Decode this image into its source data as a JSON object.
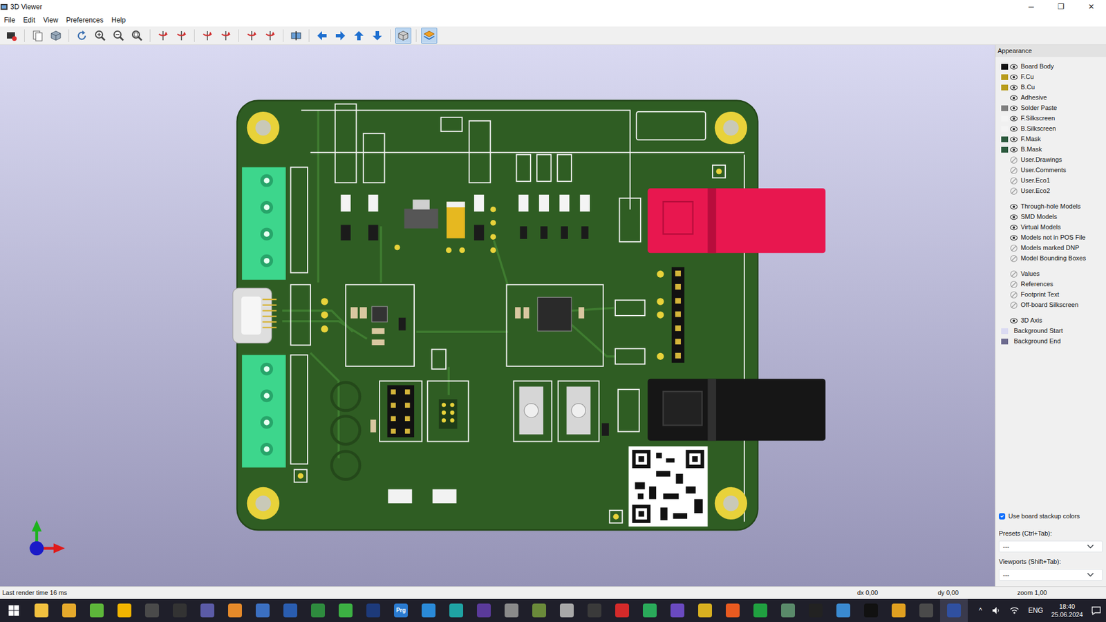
{
  "window": {
    "title": "3D Viewer",
    "controls": [
      "─",
      "❐",
      "✕"
    ]
  },
  "menu": [
    "File",
    "Edit",
    "View",
    "Preferences",
    "Help"
  ],
  "toolbar": [
    {
      "kind": "render",
      "selected": false
    },
    {
      "kind": "sep"
    },
    {
      "kind": "copy",
      "selected": false
    },
    {
      "kind": "board",
      "selected": false
    },
    {
      "kind": "sep"
    },
    {
      "kind": "reload",
      "selected": false
    },
    {
      "kind": "zoom-in",
      "selected": false
    },
    {
      "kind": "zoom-out",
      "selected": false
    },
    {
      "kind": "zoom-fit",
      "selected": false
    },
    {
      "kind": "sep"
    },
    {
      "kind": "rotate",
      "selected": false
    },
    {
      "kind": "rotate",
      "selected": false
    },
    {
      "kind": "sep"
    },
    {
      "kind": "rotate",
      "selected": false
    },
    {
      "kind": "rotate",
      "selected": false
    },
    {
      "kind": "sep"
    },
    {
      "kind": "rotate",
      "selected": false
    },
    {
      "kind": "rotate",
      "selected": false
    },
    {
      "kind": "sep"
    },
    {
      "kind": "flip",
      "selected": false
    },
    {
      "kind": "sep"
    },
    {
      "kind": "arrow-left",
      "selected": false
    },
    {
      "kind": "arrow-right",
      "selected": false
    },
    {
      "kind": "arrow-up",
      "selected": false
    },
    {
      "kind": "arrow-down",
      "selected": false
    },
    {
      "kind": "sep"
    },
    {
      "kind": "ortho",
      "selected": true
    },
    {
      "kind": "sep"
    },
    {
      "kind": "layers",
      "selected": true
    }
  ],
  "appearance": {
    "title": "Appearance",
    "groups": [
      [
        {
          "label": "Board Body",
          "kind": "layer",
          "visible": true,
          "color": "#111111"
        },
        {
          "label": "F.Cu",
          "kind": "layer",
          "visible": true,
          "color": "#b89c1c"
        },
        {
          "label": "B.Cu",
          "kind": "layer",
          "visible": true,
          "color": "#b89c1c"
        },
        {
          "label": "Adhesive",
          "kind": "layer",
          "visible": true
        },
        {
          "label": "Solder Paste",
          "kind": "layer",
          "visible": true,
          "color": "#808080"
        },
        {
          "label": "F.Silkscreen",
          "kind": "layer",
          "visible": true,
          "color": "#f4f4f4"
        },
        {
          "label": "B.Silkscreen",
          "kind": "layer",
          "visible": true,
          "color": "#f4f4f4"
        },
        {
          "label": "F.Mask",
          "kind": "layer",
          "visible": true,
          "color": "#2c5a3e"
        },
        {
          "label": "B.Mask",
          "kind": "layer",
          "visible": true,
          "color": "#2c5a3e"
        },
        {
          "label": "User.Drawings",
          "kind": "layer",
          "visible": false
        },
        {
          "label": "User.Comments",
          "kind": "layer",
          "visible": false
        },
        {
          "label": "User.Eco1",
          "kind": "layer",
          "visible": false
        },
        {
          "label": "User.Eco2",
          "kind": "layer",
          "visible": false
        }
      ],
      [
        {
          "label": "Through-hole Models",
          "kind": "layer",
          "visible": true
        },
        {
          "label": "SMD Models",
          "kind": "layer",
          "visible": true
        },
        {
          "label": "Virtual Models",
          "kind": "layer",
          "visible": true
        },
        {
          "label": "Models not in POS File",
          "kind": "layer",
          "visible": true
        },
        {
          "label": "Models marked DNP",
          "kind": "layer",
          "visible": false
        },
        {
          "label": "Model Bounding Boxes",
          "kind": "layer",
          "visible": false
        }
      ],
      [
        {
          "label": "Values",
          "kind": "layer",
          "visible": false
        },
        {
          "label": "References",
          "kind": "layer",
          "visible": false
        },
        {
          "label": "Footprint Text",
          "kind": "layer",
          "visible": false
        },
        {
          "label": "Off-board Silkscreen",
          "kind": "layer",
          "visible": false
        }
      ],
      [
        {
          "label": "3D Axis",
          "kind": "layer",
          "visible": true
        },
        {
          "label": "Background Start",
          "kind": "color-only",
          "color": "#dadaf2"
        },
        {
          "label": "Background End",
          "kind": "color-only",
          "color": "#6d6b8f"
        }
      ]
    ],
    "stackup": {
      "label": "Use board stackup colors",
      "checked": true
    },
    "presets": {
      "label": "Presets (Ctrl+Tab):",
      "value": "---"
    },
    "viewports": {
      "label": "Viewports (Shift+Tab):",
      "value": "---"
    }
  },
  "status_bar": [
    "Last render time 16 ms",
    "dx 0,00",
    "dy 0,00",
    "zoom 1,00"
  ],
  "taskbar": {
    "apps": [
      {
        "color": "#f2c13f",
        "selected": false
      },
      {
        "color": "#e5a92c",
        "selected": false
      },
      {
        "color": "#5db63a",
        "selected": false
      },
      {
        "color": "#f1b400",
        "selected": false
      },
      {
        "color": "#4a4a4a",
        "selected": false
      },
      {
        "color": "#333333",
        "selected": false
      },
      {
        "color": "#5b5ba6",
        "selected": false
      },
      {
        "color": "#e58a2a",
        "selected": false
      },
      {
        "color": "#3b6fc1",
        "selected": false
      },
      {
        "color": "#2a5db0",
        "selected": false
      },
      {
        "color": "#2e8b3e",
        "selected": false
      },
      {
        "color": "#3cb043",
        "selected": false
      },
      {
        "color": "#1d3a7a",
        "selected": false
      },
      {
        "color": "#2a7ad0",
        "selected": false,
        "label": "Prg"
      },
      {
        "color": "#2a8ad8",
        "selected": false
      },
      {
        "color": "#1fa3a3",
        "selected": false
      },
      {
        "color": "#5a3a9a",
        "selected": false
      },
      {
        "color": "#8a8a8a",
        "selected": false
      },
      {
        "color": "#6a8a3a",
        "selected": false
      },
      {
        "color": "#a8a8a8",
        "selected": false
      },
      {
        "color": "#3a3a3a",
        "selected": false
      },
      {
        "color": "#d42a2a",
        "selected": false
      },
      {
        "color": "#2aaa5a",
        "selected": false
      },
      {
        "color": "#6a4ac0",
        "selected": false
      },
      {
        "color": "#d8b020",
        "selected": false
      },
      {
        "color": "#e85a20",
        "selected": false
      },
      {
        "color": "#20a040",
        "selected": false
      },
      {
        "color": "#5a8a6a",
        "selected": false
      },
      {
        "color": "#222222",
        "selected": false
      },
      {
        "color": "#3a8ad0",
        "selected": false
      },
      {
        "color": "#111111",
        "selected": false
      },
      {
        "color": "#e0a020",
        "selected": false
      },
      {
        "color": "#4a4a4a",
        "selected": false
      },
      {
        "color": "#3050a0",
        "selected": true
      }
    ],
    "tray": {
      "chevron": "^",
      "language": "ENG",
      "time": "18:40",
      "date": "25.06.2024"
    }
  }
}
